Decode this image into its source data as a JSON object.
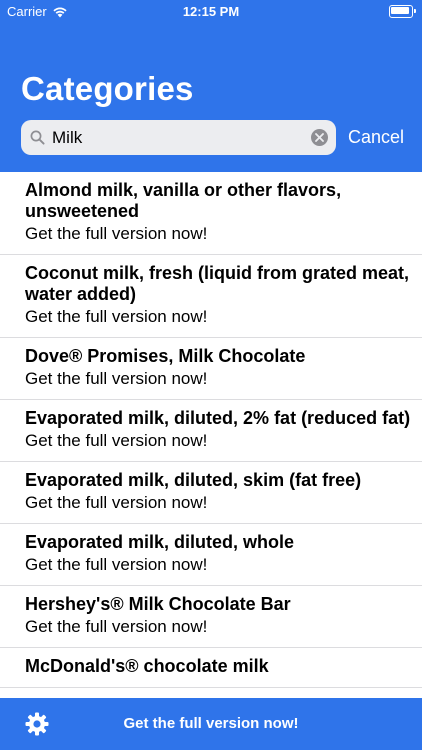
{
  "status_bar": {
    "carrier": "Carrier",
    "time": "12:15 PM"
  },
  "header": {
    "title": "Categories"
  },
  "search": {
    "value": "Milk",
    "cancel_label": "Cancel"
  },
  "results": [
    {
      "title": "Almond milk, vanilla or other flavors, unsweetened",
      "subtitle": "Get the full version now!"
    },
    {
      "title": "Coconut milk, fresh (liquid from grated meat, water added)",
      "subtitle": "Get the full version now!"
    },
    {
      "title": "Dove® Promises, Milk Chocolate",
      "subtitle": "Get the full version now!"
    },
    {
      "title": "Evaporated milk, diluted, 2% fat (reduced fat)",
      "subtitle": "Get the full version now!"
    },
    {
      "title": "Evaporated milk, diluted, skim (fat free)",
      "subtitle": "Get the full version now!"
    },
    {
      "title": "Evaporated milk, diluted, whole",
      "subtitle": "Get the full version now!"
    },
    {
      "title": "Hershey's® Milk Chocolate Bar",
      "subtitle": "Get the full version now!"
    },
    {
      "title": "McDonald's® chocolate milk",
      "subtitle": ""
    }
  ],
  "bottom_bar": {
    "label": "Get the full version now!",
    "icon": "gear-icon"
  },
  "colors": {
    "accent": "#2f74ea"
  }
}
